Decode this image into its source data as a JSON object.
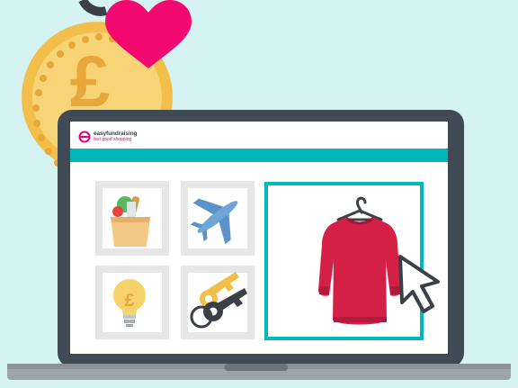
{
  "brand": {
    "name": "easyfundraising",
    "tagline": "feel good shopping",
    "logo_color": "#e6007e",
    "accent_color": "#00b8bc"
  },
  "tiles": [
    {
      "icon": "grocery-bag-icon",
      "selected": false
    },
    {
      "icon": "airplane-icon",
      "selected": false
    },
    {
      "icon": "lightbulb-icon",
      "selected": false
    },
    {
      "icon": "keys-icon",
      "selected": false
    },
    {
      "icon": "sweater-icon",
      "selected": true
    }
  ],
  "decorations": [
    "pound-coin-icon",
    "heart-icon",
    "mouse-pointer-icon",
    "laptop-icon"
  ]
}
